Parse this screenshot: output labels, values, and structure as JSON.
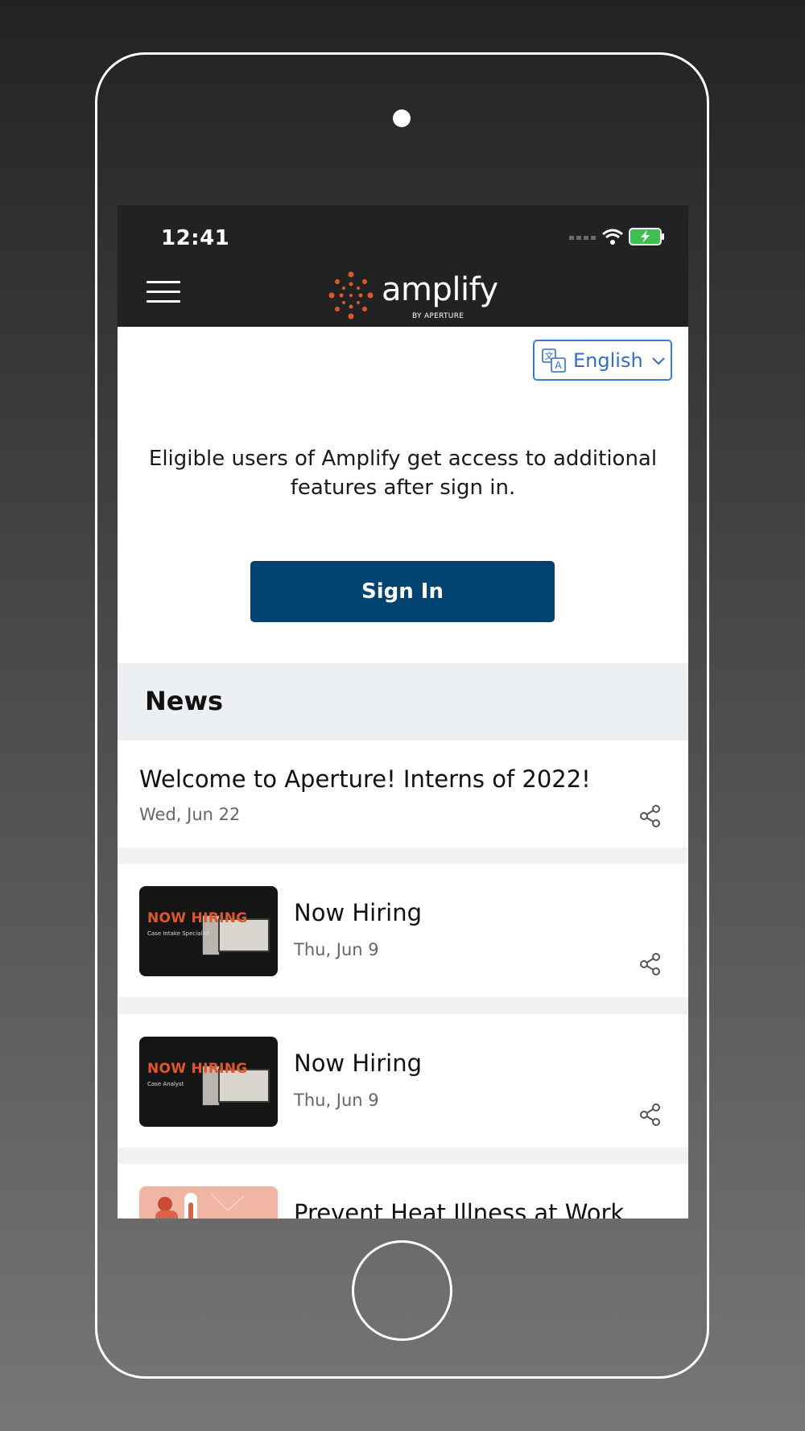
{
  "status_bar": {
    "time": "12:41"
  },
  "app_bar": {
    "logo_text": "amplify",
    "logo_subtext": "BY APERTURE",
    "brand_color": "#e0572a"
  },
  "language": {
    "selected": "English"
  },
  "intro": {
    "text": "Eligible users of Amplify get access to additional features after sign in."
  },
  "signin": {
    "label": "Sign In"
  },
  "news": {
    "title": "News",
    "items": [
      {
        "title": "Welcome to Aperture! Interns of 2022!",
        "date": "Wed, Jun 22"
      },
      {
        "title": "Now Hiring",
        "date": "Thu, Jun 9",
        "thumb_title": "NOW HIRING",
        "thumb_sub": "Case Intake Specialist"
      },
      {
        "title": "Now Hiring",
        "date": "Thu, Jun 9",
        "thumb_title": "NOW HIRING",
        "thumb_sub": "Case Analyst"
      },
      {
        "title": "Prevent Heat Illness at Work"
      }
    ]
  }
}
